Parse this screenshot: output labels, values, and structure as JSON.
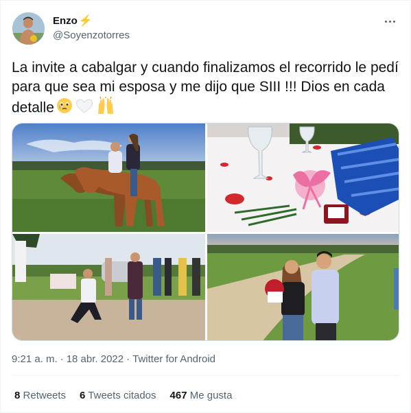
{
  "author": {
    "display_name": "Enzo",
    "badge_icon": "lightning-icon",
    "handle": "@Soyenzotorres"
  },
  "tweet": {
    "text": "La invite a cabalgar y cuando finalizamos el recorrido le pedí para que sea mi esposa y me dijo que SIII !!! Dios en cada detalle",
    "emojis": [
      "face-holding-back-tears-emoji",
      "white-heart-emoji",
      "raised-hands-emoji"
    ]
  },
  "meta": {
    "time": "9:21 a. m.",
    "separator1": "·",
    "date": "18 abr. 2022",
    "separator2": "·",
    "source": "Twitter for Android"
  },
  "stats": {
    "retweets_count": "8",
    "retweets_label": "Retweets",
    "quotes_count": "6",
    "quotes_label": "Tweets citados",
    "likes_count": "467",
    "likes_label": "Me gusta"
  },
  "colors": {
    "text_primary": "#0f1419",
    "text_secondary": "#536471",
    "border": "#cfd9de",
    "divider": "#eff3f4"
  }
}
